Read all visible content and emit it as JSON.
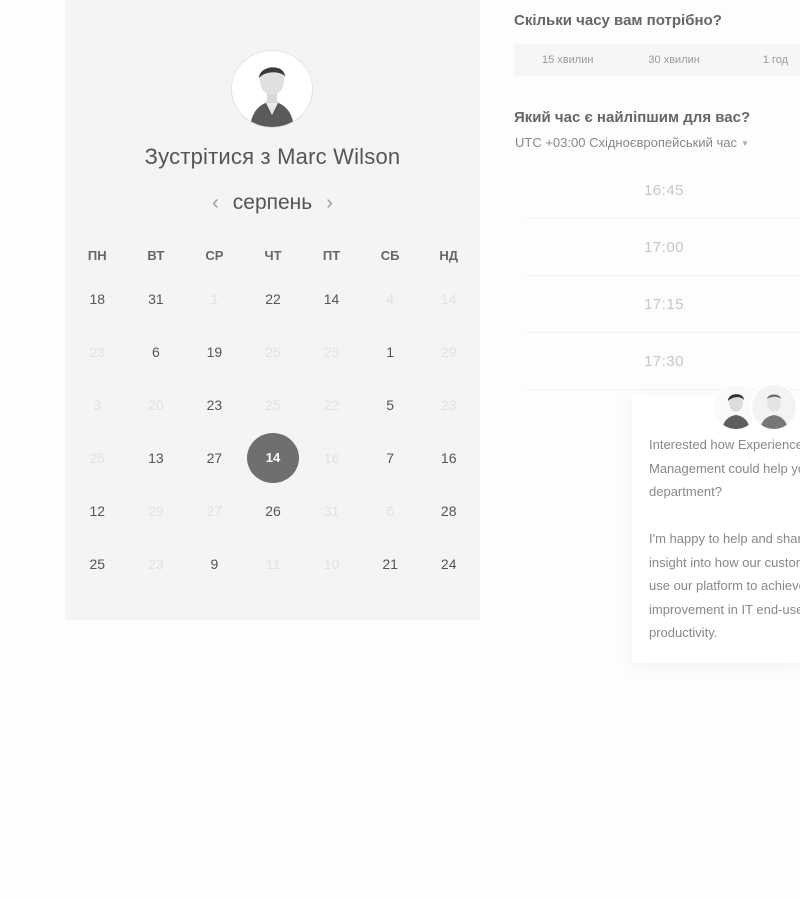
{
  "scheduler": {
    "title": "Зустрітися з Marc Wilson",
    "month": "серпень",
    "prev_icon": "chevron-left-icon",
    "next_icon": "chevron-right-icon",
    "weekdays": [
      "ПН",
      "ВТ",
      "СР",
      "ЧТ",
      "ПТ",
      "СБ",
      "НД"
    ],
    "weeks": [
      [
        {
          "d": "18"
        },
        {
          "d": "31"
        },
        {
          "d": "1",
          "muted": true
        },
        {
          "d": "22"
        },
        {
          "d": "14"
        },
        {
          "d": "4",
          "muted": true
        },
        {
          "d": "14",
          "muted": true
        }
      ],
      [
        {
          "d": "23",
          "muted": true
        },
        {
          "d": "6"
        },
        {
          "d": "19"
        },
        {
          "d": "25",
          "muted": true
        },
        {
          "d": "25",
          "muted": true
        },
        {
          "d": "1"
        },
        {
          "d": "29",
          "muted": true
        }
      ],
      [
        {
          "d": "3",
          "muted": true
        },
        {
          "d": "20",
          "muted": true
        },
        {
          "d": "23"
        },
        {
          "d": "25",
          "muted": true
        },
        {
          "d": "22",
          "muted": true
        },
        {
          "d": "5"
        },
        {
          "d": "23",
          "muted": true
        }
      ],
      [
        {
          "d": "25",
          "muted": true
        },
        {
          "d": "13"
        },
        {
          "d": "27"
        },
        {
          "d": "14",
          "selected": true
        },
        {
          "d": "16",
          "muted": true
        },
        {
          "d": "7"
        },
        {
          "d": "16"
        }
      ],
      [
        {
          "d": "12"
        },
        {
          "d": "29",
          "muted": true
        },
        {
          "d": "27",
          "muted": true
        },
        {
          "d": "26"
        },
        {
          "d": "31",
          "muted": true
        },
        {
          "d": "6",
          "muted": true
        },
        {
          "d": "28"
        }
      ],
      [
        {
          "d": "25"
        },
        {
          "d": "23",
          "muted": true
        },
        {
          "d": "9"
        },
        {
          "d": "11",
          "muted": true
        },
        {
          "d": "10",
          "muted": true
        },
        {
          "d": "21"
        },
        {
          "d": "24"
        }
      ]
    ]
  },
  "booking": {
    "duration_question": "Скільки часу вам потрібно?",
    "durations": [
      "15 хвилин",
      "30 хвилин",
      "1 год"
    ],
    "time_question": "Який час є найліпшим для вас?",
    "timezone": "UTC +03:00 Східноєвропейський час",
    "slots": [
      "16:45",
      "17:00",
      "17:15",
      "17:30"
    ]
  },
  "chat": {
    "lines": [
      "Interested how Experience",
      "Management could help your",
      "department?",
      "",
      "I'm happy to help and share",
      "insight into how our customers",
      "use our platform to achieve",
      "improvement in IT end-user",
      "productivity."
    ]
  },
  "colors": {
    "card_bg": "#f4f4f4",
    "selected_day": "#6f6f6f",
    "muted_text": "#e2e2e2"
  }
}
